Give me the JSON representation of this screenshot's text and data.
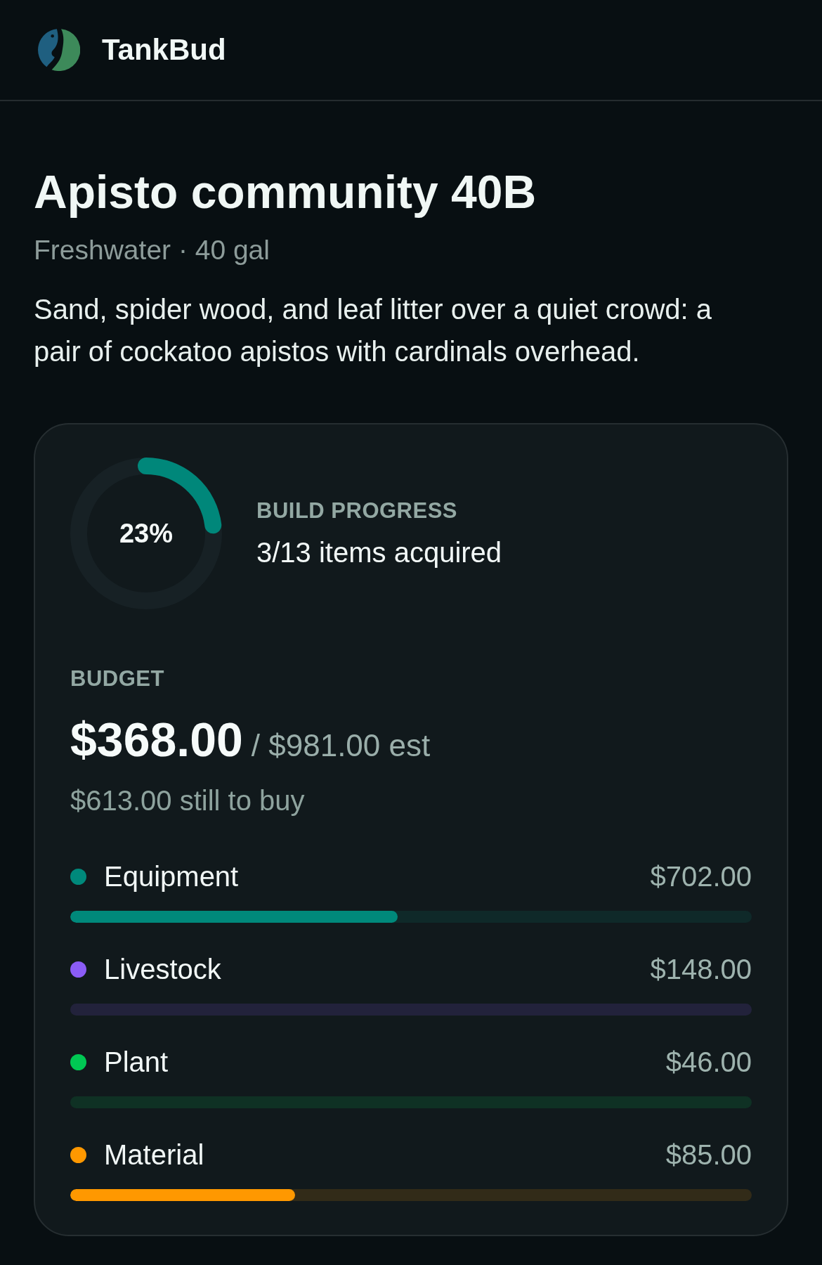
{
  "header": {
    "app_name": "TankBud"
  },
  "tank": {
    "title": "Apisto community 40B",
    "subtitle": "Freshwater · 40 gal",
    "description": "Sand, spider wood, and leaf litter over a quiet crowd: a pair of cockatoo apistos with cardinals overhead."
  },
  "progress": {
    "level": 0.23,
    "percent": "23%",
    "label": "BUILD PROGRESS",
    "summary": "3/13 items acquired"
  },
  "budget": {
    "label": "BUDGET",
    "spent": "$368.00",
    "estimate": "/ $981.00 est",
    "remaining": "$613.00 still to buy"
  },
  "categories": [
    {
      "name": "Equipment",
      "amount": "$702.00",
      "color": "#00897b",
      "level": 0.48
    },
    {
      "name": "Livestock",
      "amount": "$148.00",
      "color": "#8b5cf6",
      "level": 0
    },
    {
      "name": "Plant",
      "amount": "$46.00",
      "color": "#00c853",
      "level": 0
    },
    {
      "name": "Material",
      "amount": "$85.00",
      "color": "#ff9800",
      "level": 0.33
    }
  ]
}
